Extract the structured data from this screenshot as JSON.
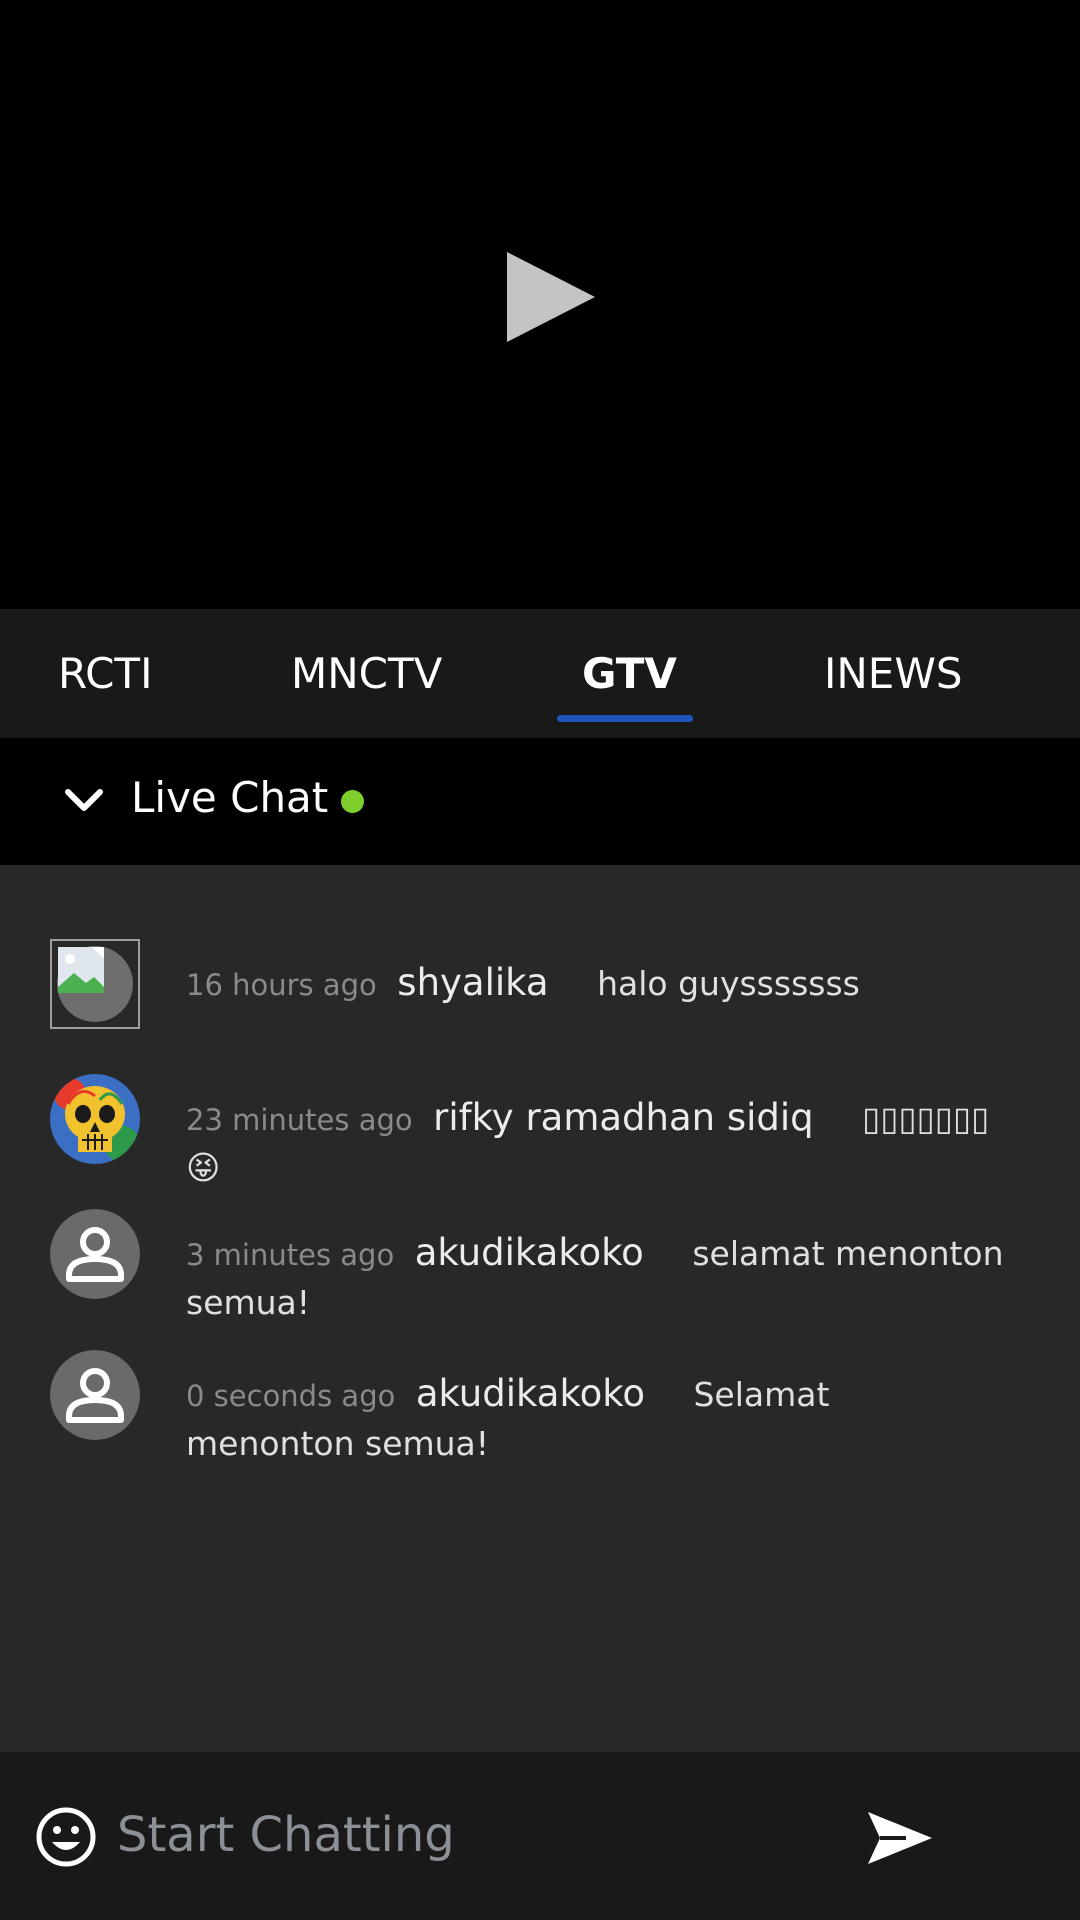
{
  "tabs": [
    {
      "label": "RCTI",
      "active": false
    },
    {
      "label": "MNCTV",
      "active": false
    },
    {
      "label": "GTV",
      "active": true
    },
    {
      "label": "INEWS",
      "active": false
    }
  ],
  "chat_header": {
    "title": "Live Chat",
    "status_color": "#7ecf2b"
  },
  "messages": [
    {
      "time": "16 hours ago",
      "user": "shyalika",
      "text": "halo guysssssss",
      "avatar": "broken-image-icon"
    },
    {
      "time": "23 minutes ago",
      "user": "rifky ramadhan sidiq",
      "text": "▯▯▯▯▯▯▯😝",
      "avatar": "skull-art-avatar"
    },
    {
      "time": "3 minutes ago",
      "user": "akudikakoko",
      "text": "selamat menonton semua!",
      "avatar": "person-icon"
    },
    {
      "time": "0 seconds ago",
      "user": "akudikakoko",
      "text": "Selamat menonton semua!",
      "avatar": "person-icon"
    }
  ],
  "input": {
    "placeholder": "Start Chatting",
    "value": ""
  },
  "colors": {
    "accent": "#1d56b8",
    "live": "#7ecf2b",
    "background": "#282828"
  }
}
